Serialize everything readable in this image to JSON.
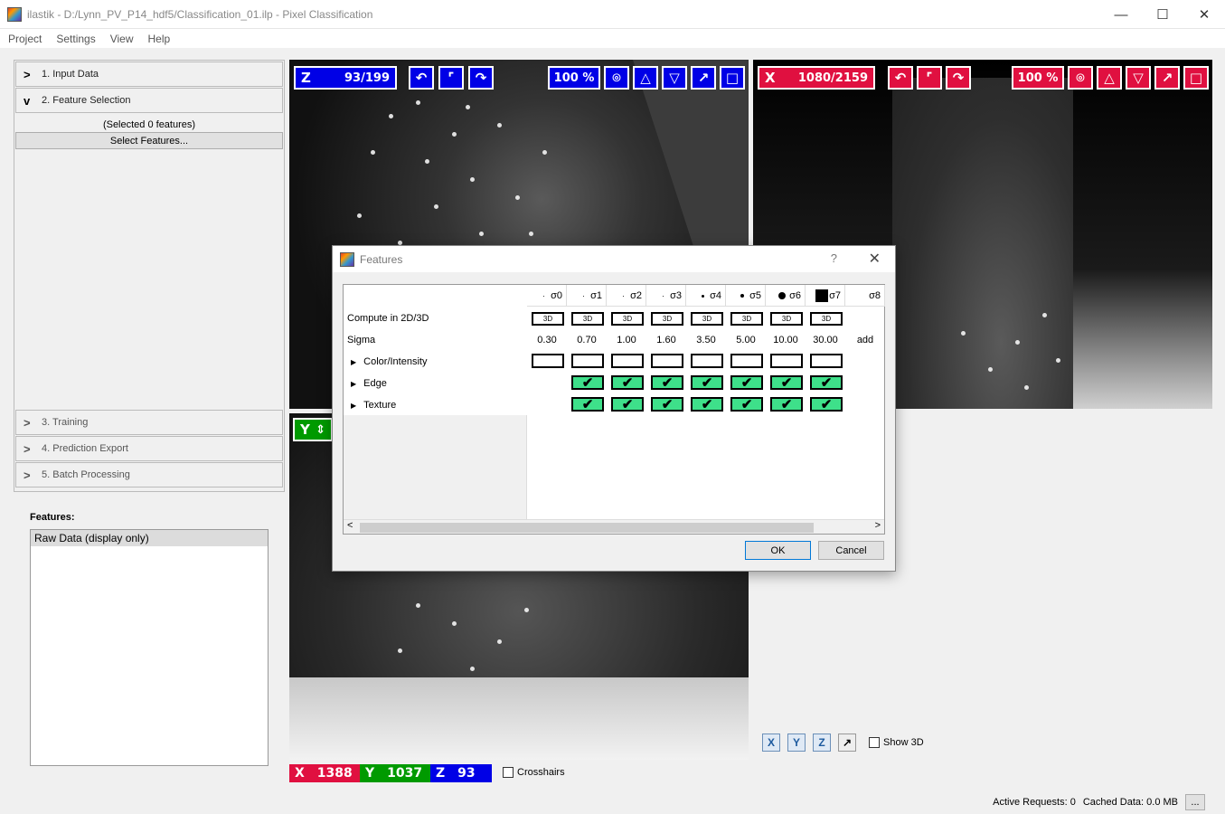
{
  "window": {
    "title": "ilastik - D:/Lynn_PV_P14_hdf5/Classification_01.ilp - Pixel Classification",
    "minimize": "—",
    "maximize": "☐",
    "close": "✕"
  },
  "menu": [
    "Project",
    "Settings",
    "View",
    "Help"
  ],
  "applets": {
    "input_data": "1. Input Data",
    "feature_selection": "2. Feature Selection",
    "selected_count": "(Selected 0 features)",
    "select_features_button": "Select Features...",
    "training": "3. Training",
    "prediction_export": "4. Prediction Export",
    "batch_processing": "5. Batch Processing"
  },
  "features_panel": {
    "label": "Features:",
    "items": [
      "Raw Data (display only)"
    ]
  },
  "viewer_z": {
    "axis": "Z",
    "position": "93/199",
    "zoom": "100 %"
  },
  "viewer_x": {
    "axis": "X",
    "position": "1080/2159",
    "zoom": "100 %"
  },
  "viewer_y": {
    "axis": "Y"
  },
  "coords": {
    "x_label": "X",
    "x": "1388",
    "y_label": "Y",
    "y": "1037",
    "z_label": "Z",
    "z": "93"
  },
  "crosshairs_label": "Crosshairs",
  "view_tools": {
    "x": "X",
    "y": "Y",
    "z": "Z",
    "show3d": "Show 3D"
  },
  "status": {
    "active_requests": "Active Requests: 0",
    "cached": "Cached Data: 0.0 MB",
    "more": "..."
  },
  "dialog": {
    "title": "Features",
    "help": "?",
    "close": "✕",
    "rows": {
      "compute": "Compute in 2D/3D",
      "sigma": "Sigma",
      "color": "Color/Intensity",
      "edge": "Edge",
      "texture": "Texture"
    },
    "sigma_headers": [
      "σ0",
      "σ1",
      "σ2",
      "σ3",
      "σ4",
      "σ5",
      "σ6",
      "σ7",
      "σ8"
    ],
    "sigma_values": [
      "0.30",
      "0.70",
      "1.00",
      "1.60",
      "3.50",
      "5.00",
      "10.00",
      "30.00",
      "add"
    ],
    "box3d_label": "3D",
    "edge_checked": [
      false,
      true,
      true,
      true,
      true,
      true,
      true,
      true
    ],
    "texture_checked": [
      false,
      true,
      true,
      true,
      true,
      true,
      true,
      true
    ],
    "ok": "OK",
    "cancel": "Cancel"
  },
  "colors": {
    "z_axis": "#0000e6",
    "x_axis": "#e01040",
    "y_axis": "#009a00",
    "checked": "#3ee08a"
  }
}
